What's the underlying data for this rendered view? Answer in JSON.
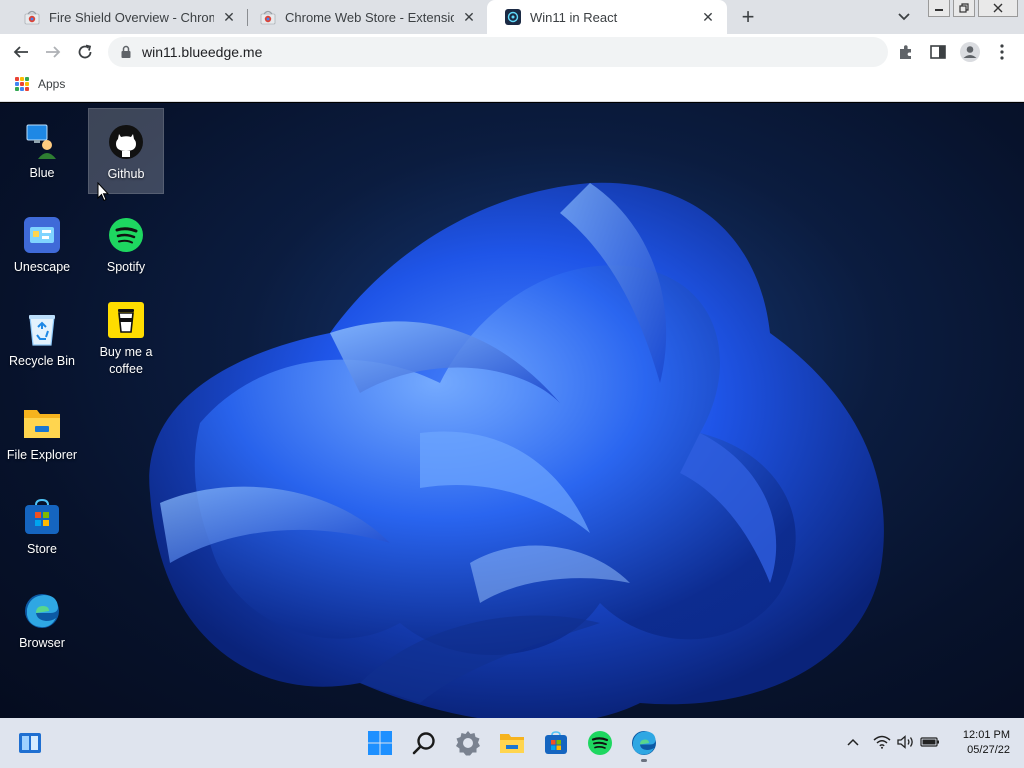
{
  "browser": {
    "tabs": [
      {
        "title": "Fire Shield Overview - Chrome W",
        "active": false,
        "favicon": "chrome-store-icon"
      },
      {
        "title": "Chrome Web Store - Extensions",
        "active": false,
        "favicon": "chrome-store-icon"
      },
      {
        "title": "Win11 in React",
        "active": true,
        "favicon": "win11-icon"
      }
    ],
    "new_tab_label": "+",
    "url": "win11.blueedge.me",
    "bookmarks": {
      "apps_label": "Apps"
    }
  },
  "desktop": {
    "icons": [
      {
        "label": "Blue",
        "icon": "blue-user-icon"
      },
      {
        "label": "Github",
        "icon": "github-icon",
        "selected": true
      },
      {
        "label": "Unescape",
        "icon": "unescape-icon"
      },
      {
        "label": "Spotify",
        "icon": "spotify-icon"
      },
      {
        "label": "Recycle Bin",
        "icon": "recycle-bin-icon"
      },
      {
        "label": "Buy me a coffee",
        "icon": "coffee-icon"
      },
      {
        "label": "File Explorer",
        "icon": "folder-icon"
      },
      {
        "label": "Store",
        "icon": "store-icon"
      },
      {
        "label": "Browser",
        "icon": "edge-icon"
      }
    ]
  },
  "taskbar": {
    "apps": [
      "start-icon",
      "search-icon",
      "settings-icon",
      "file-explorer-icon",
      "store-icon",
      "spotify-icon",
      "edge-icon"
    ],
    "tray": [
      "chevron-up-icon",
      "wifi-icon",
      "volume-icon",
      "battery-icon"
    ],
    "time": "12:01 PM",
    "date": "05/27/22"
  },
  "colors": {
    "accent": "#0078d4",
    "spotify": "#1ed760",
    "coffee": "#ffdd00",
    "taskbar": "#dfe4ee"
  }
}
